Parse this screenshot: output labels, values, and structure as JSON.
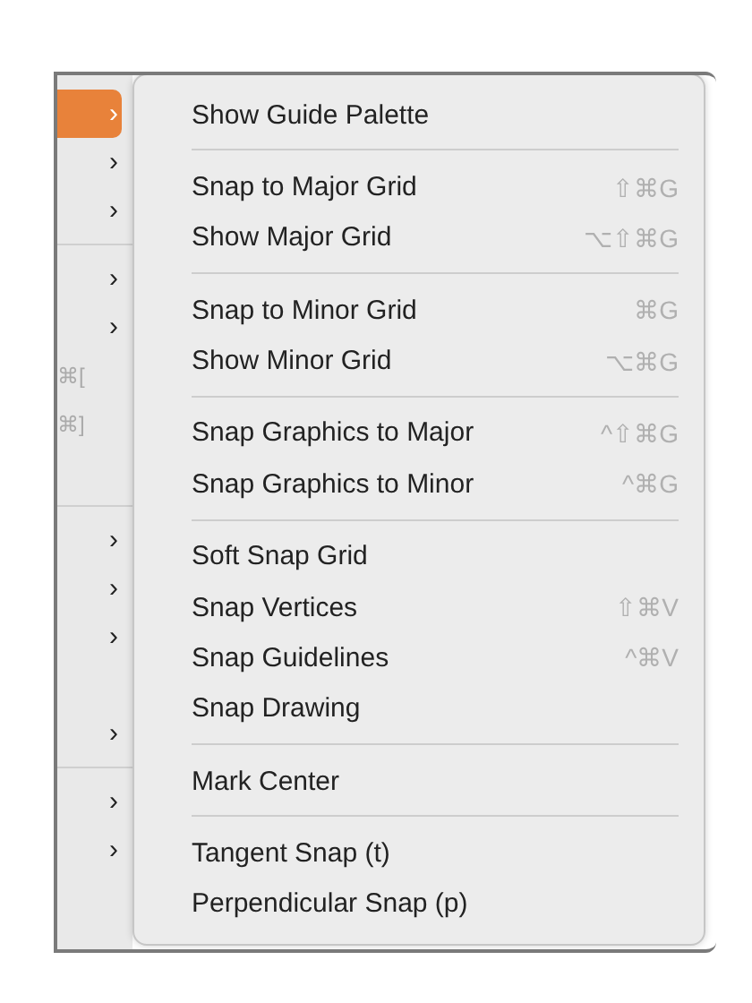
{
  "parent_menu": {
    "items": [
      {
        "kind": "chevron",
        "label": "›",
        "selected": true
      },
      {
        "kind": "chevron",
        "label": "›",
        "selected": false
      },
      {
        "kind": "chevron",
        "label": "›",
        "selected": false
      },
      {
        "kind": "separator"
      },
      {
        "kind": "chevron",
        "label": "›",
        "selected": false
      },
      {
        "kind": "chevron",
        "label": "›",
        "selected": false
      },
      {
        "kind": "shortcut",
        "label": "⌘[",
        "selected": false
      },
      {
        "kind": "shortcut",
        "label": "⌘]",
        "selected": false
      },
      {
        "kind": "blank"
      },
      {
        "kind": "separator"
      },
      {
        "kind": "chevron",
        "label": "›",
        "selected": false
      },
      {
        "kind": "chevron",
        "label": "›",
        "selected": false
      },
      {
        "kind": "chevron",
        "label": "›",
        "selected": false
      },
      {
        "kind": "blank"
      },
      {
        "kind": "chevron",
        "label": "›",
        "selected": false
      },
      {
        "kind": "separator"
      },
      {
        "kind": "chevron",
        "label": "›",
        "selected": false
      },
      {
        "kind": "chevron",
        "label": "›",
        "selected": false
      }
    ]
  },
  "submenu": {
    "items": [
      {
        "kind": "item",
        "label": "Show Guide Palette"
      },
      {
        "kind": "separator"
      },
      {
        "kind": "item",
        "label": "Snap to Major Grid",
        "shortcut": "⇧⌘G"
      },
      {
        "kind": "item",
        "label": "Show Major Grid",
        "shortcut": "⌥⇧⌘G"
      },
      {
        "kind": "separator"
      },
      {
        "kind": "item",
        "label": "Snap to Minor Grid",
        "shortcut": "⌘G"
      },
      {
        "kind": "item",
        "label": "Show Minor Grid",
        "shortcut": "⌥⌘G"
      },
      {
        "kind": "separator"
      },
      {
        "kind": "item",
        "label": "Snap Graphics to Major",
        "shortcut": "^⇧⌘G"
      },
      {
        "kind": "item",
        "label": "Snap Graphics to Minor",
        "shortcut": "^⌘G"
      },
      {
        "kind": "separator"
      },
      {
        "kind": "item",
        "label": "Soft Snap Grid"
      },
      {
        "kind": "item",
        "label": "Snap Vertices",
        "shortcut": "⇧⌘V"
      },
      {
        "kind": "item",
        "label": "Snap Guidelines",
        "shortcut": "^⌘V"
      },
      {
        "kind": "item",
        "label": "Snap Drawing"
      },
      {
        "kind": "separator"
      },
      {
        "kind": "item",
        "label": "Mark Center"
      },
      {
        "kind": "separator"
      },
      {
        "kind": "item",
        "label": "Tangent Snap (t)"
      },
      {
        "kind": "item",
        "label": "Perpendicular Snap (p)"
      }
    ]
  }
}
